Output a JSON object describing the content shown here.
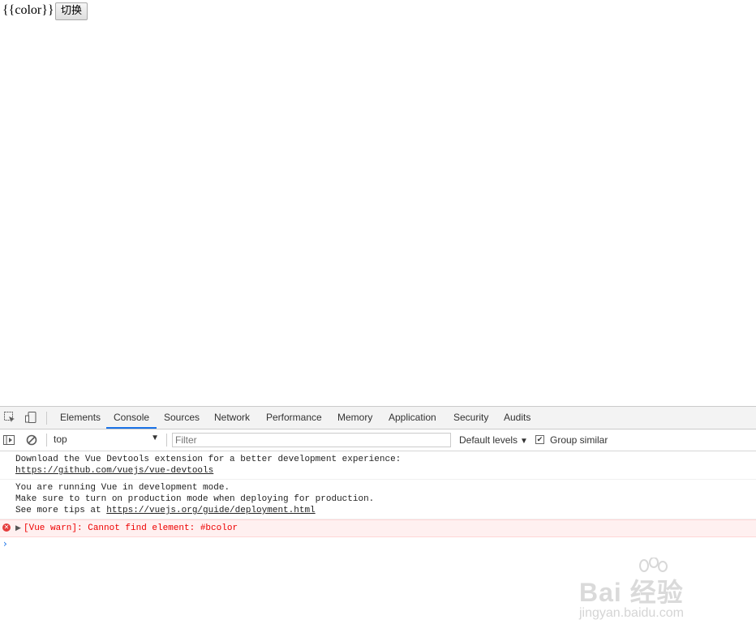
{
  "page": {
    "vue_template_text": "{{color}}",
    "toggle_button_label": "切换"
  },
  "devtools": {
    "tabs": [
      {
        "label": "Elements"
      },
      {
        "label": "Console",
        "active": true
      },
      {
        "label": "Sources"
      },
      {
        "label": "Network"
      },
      {
        "label": "Performance"
      },
      {
        "label": "Memory"
      },
      {
        "label": "Application"
      },
      {
        "label": "Security"
      },
      {
        "label": "Audits"
      }
    ],
    "console_toolbar": {
      "context": "top",
      "filter_placeholder": "Filter",
      "levels_label": "Default levels",
      "group_similar_label": "Group similar",
      "group_similar_checked": true
    },
    "messages": [
      {
        "type": "log",
        "line1": "Download the Vue Devtools extension for a better development experience:",
        "link": "https://github.com/vuejs/vue-devtools"
      },
      {
        "type": "log",
        "line1": "You are running Vue in development mode.",
        "line2": "Make sure to turn on production mode when deploying for production.",
        "line3_prefix": "See more tips at ",
        "link": "https://vuejs.org/guide/deployment.html"
      },
      {
        "type": "error",
        "text": "[Vue warn]: Cannot find element: #bcolor"
      }
    ],
    "prompt_symbol": "›"
  },
  "watermark": {
    "brand": "Bai 经验",
    "url": "jingyan.baidu.com"
  },
  "colors": {
    "accent": "#1a73e8",
    "error": "#e00000",
    "error_bg": "#fff0f0"
  }
}
